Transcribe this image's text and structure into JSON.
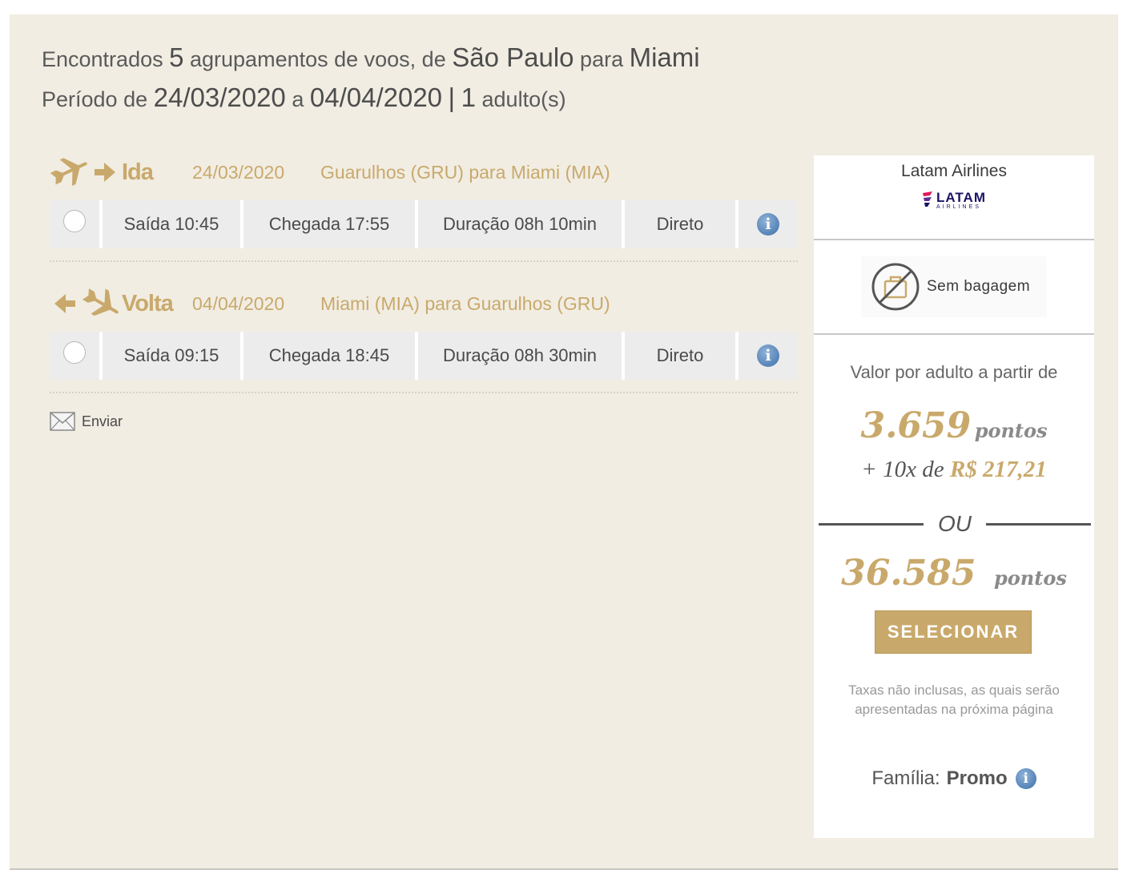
{
  "summary": {
    "line1": {
      "t1": "Encontrados",
      "count": "5",
      "t2": "agrupamentos de voos, de",
      "origin": "São Paulo",
      "t3": "para",
      "destination": "Miami"
    },
    "line2": {
      "t1": "Período de",
      "start": "24/03/2020",
      "t2": "a",
      "end": "04/04/2020",
      "sep": "|",
      "adults": "1",
      "t3": "adulto(s)"
    }
  },
  "legs": [
    {
      "direction": "Ida",
      "date": "24/03/2020",
      "route": "Guarulhos (GRU) para Miami (MIA)",
      "departure": "Saída 10:45",
      "arrival": "Chegada 17:55",
      "duration": "Duração 08h 10min",
      "stops": "Direto"
    },
    {
      "direction": "Volta",
      "date": "04/04/2020",
      "route": "Miami (MIA) para Guarulhos (GRU)",
      "departure": "Saída 09:15",
      "arrival": "Chegada 18:45",
      "duration": "Duração 08h 30min",
      "stops": "Direto"
    }
  ],
  "send_label": "Enviar",
  "offer": {
    "airline": "Latam Airlines",
    "logo_main": "LATAM",
    "logo_sub": "AIRLINES",
    "baggage": "Sem bagagem",
    "price_caption": "Valor por adulto a partir de",
    "points_option1": "3.659",
    "points_word": "pontos",
    "installments_prefix": "+ 10x de",
    "installments_value": "R$ 217,21",
    "or_label": "OU",
    "points_option2": "36.585",
    "select_label": "SELECIONAR",
    "taxes_note": "Taxas não inclusas, as quais serão apresentadas na próxima página",
    "family_label": "Família:",
    "family_value": "Promo"
  },
  "colors": {
    "accent_gold": "#c9a96b",
    "panel_bg": "#f1ede3",
    "info_blue": "#3d6fa8"
  }
}
